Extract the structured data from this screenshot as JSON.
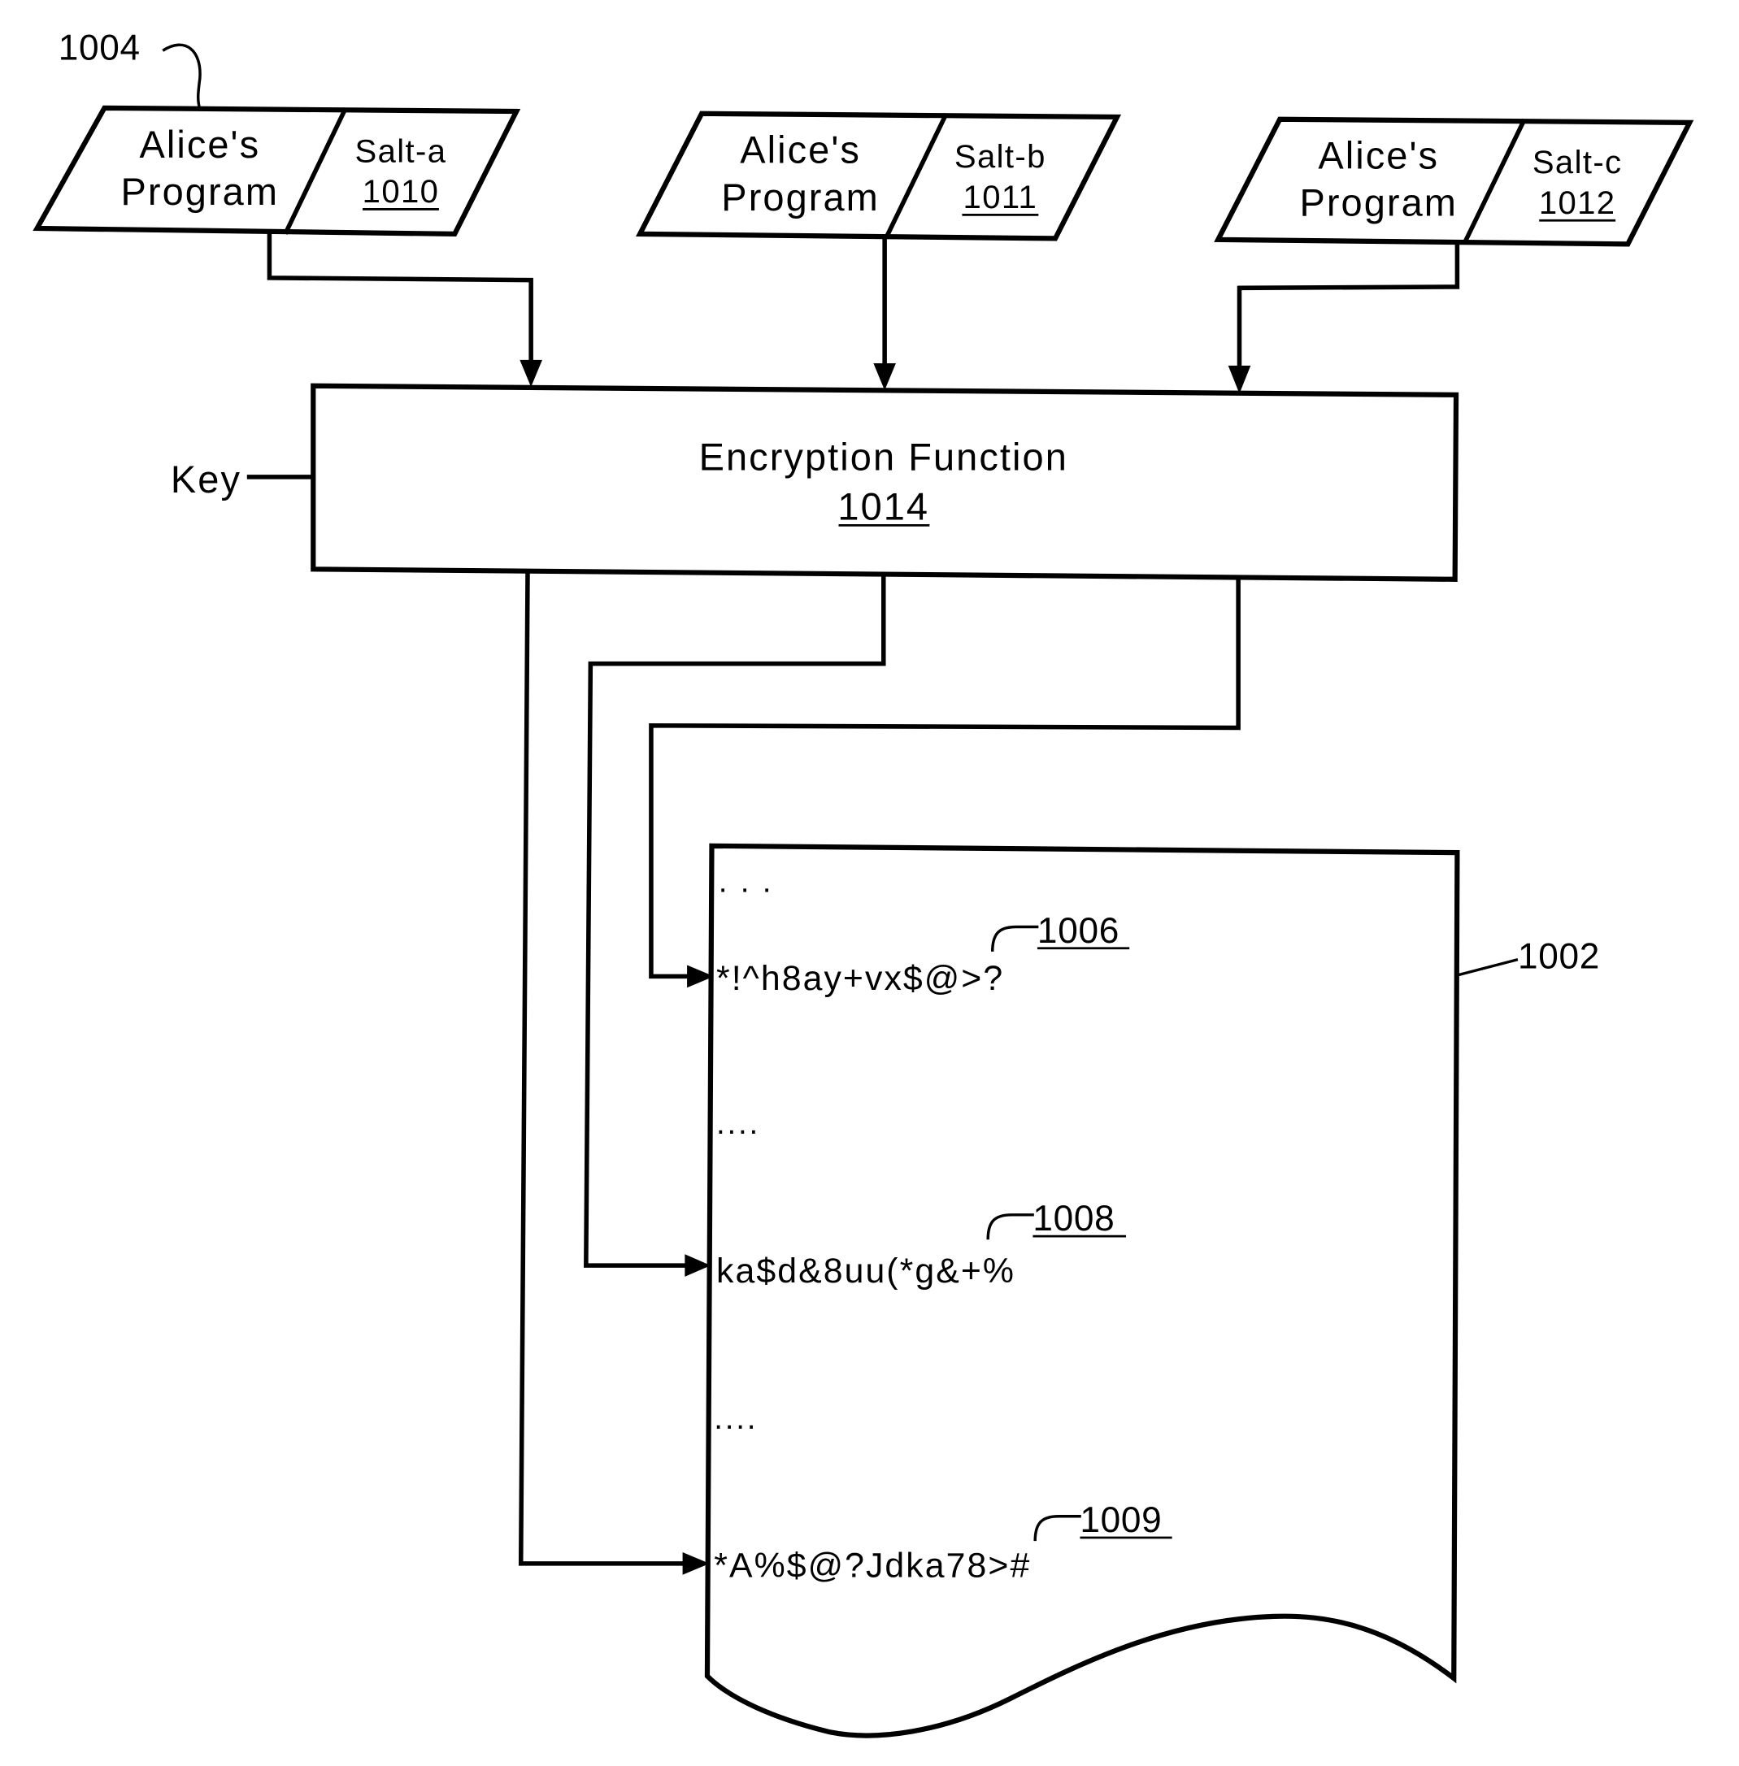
{
  "figure": {
    "inputs": [
      {
        "program_line1": "Alice's",
        "program_line2": "Program",
        "salt_label": "Salt-a",
        "salt_ref": "1010"
      },
      {
        "program_line1": "Alice's",
        "program_line2": "Program",
        "salt_label": "Salt-b",
        "salt_ref": "1011"
      },
      {
        "program_line1": "Alice's",
        "program_line2": "Program",
        "salt_label": "Salt-c",
        "salt_ref": "1012"
      }
    ],
    "input_group_ref": "1004",
    "key_label": "Key",
    "encryption": {
      "title": "Encryption Function",
      "ref": "1014"
    },
    "document": {
      "ref": "1002",
      "ellipses": [
        ". . .",
        "....",
        "...."
      ],
      "entries": [
        {
          "text": "*!^h8ay+vx$@>?",
          "ref": "1006"
        },
        {
          "text": "ka$d&8uu(*g&+%",
          "ref": "1008"
        },
        {
          "text": "*A%$@?Jdka78>#",
          "ref": "1009"
        }
      ]
    }
  }
}
